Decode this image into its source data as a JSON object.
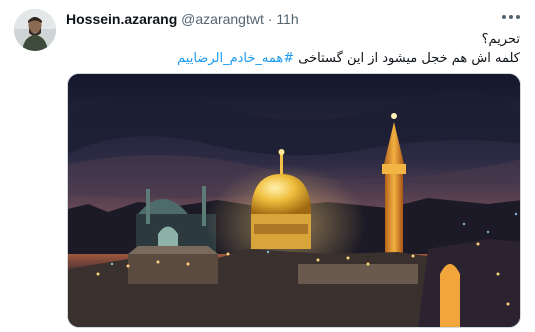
{
  "tweet": {
    "author_name": "Hossein.azarang",
    "handle": "@azarangtwt",
    "separator": "·",
    "time": "11h",
    "line1": "تحریم؟",
    "line2_text": "کلمه اش هم خجل میشود از این گستاخی ",
    "hashtag": "#همه_خادم_الرضاییم",
    "more_icon": "more-horizontal-icon",
    "avatar_icon": "user-avatar"
  },
  "media": {
    "type": "photo",
    "colors": {
      "sky_top": "#14182c",
      "sky_mid": "#3b3550",
      "sunset": "#c0673e",
      "dome": "#e7b53a",
      "lights": "#ffd27a"
    }
  }
}
